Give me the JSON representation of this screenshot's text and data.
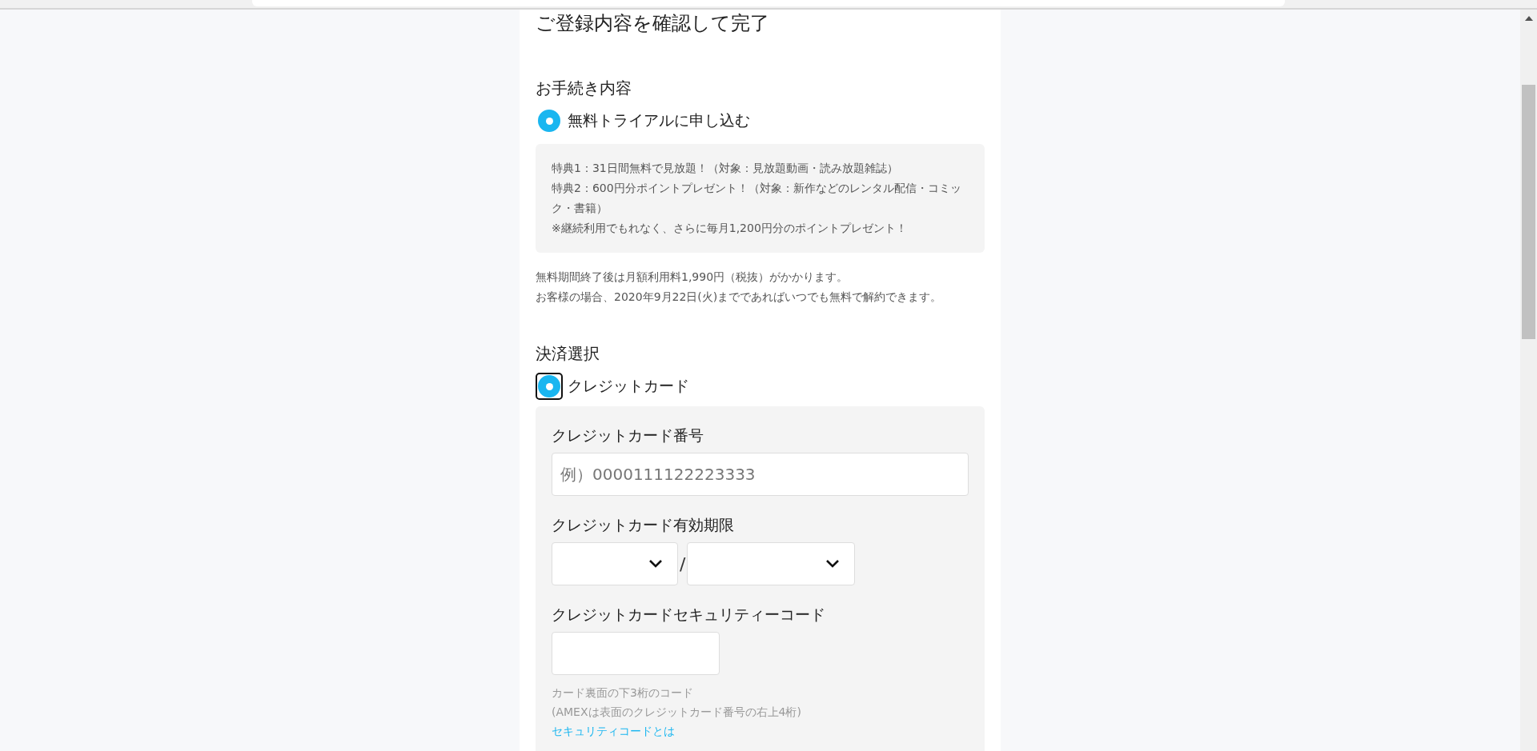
{
  "page_title": "ご登録内容を確認して完了",
  "procedure": {
    "heading": "お手続き内容",
    "option": {
      "label": "無料トライアルに申し込む",
      "selected": true,
      "focused": false
    },
    "benefits": [
      "特典1：31日間無料で見放題！（対象：見放題動画・読み放題雑誌）",
      "特典2：600円分ポイントプレゼント！（対象：新作などのレンタル配信・コミック・書籍）",
      "※継続利用でもれなく、さらに毎月1,200円分のポイントプレゼント！"
    ],
    "notes": [
      "無料期間終了後は月額利用料1,990円（税抜）がかかります。",
      "お客様の場合、2020年9月22日(火)までであればいつでも無料で解約できます。"
    ]
  },
  "payment": {
    "heading": "決済選択",
    "option": {
      "label": "クレジットカード",
      "selected": true,
      "focused": true
    },
    "fields": [
      {
        "kind": "text",
        "label": "クレジットカード番号",
        "placeholder": "例）0000111122223333"
      },
      {
        "kind": "expiry",
        "label": "クレジットカード有効期限",
        "separator": "/"
      },
      {
        "kind": "code",
        "label": "クレジットカードセキュリティーコード",
        "hints": [
          "カード裏面の下3桁のコード",
          "(AMEXは表面のクレジットカード番号の右上4桁)"
        ],
        "link": "セキュリティコードとは"
      }
    ]
  }
}
